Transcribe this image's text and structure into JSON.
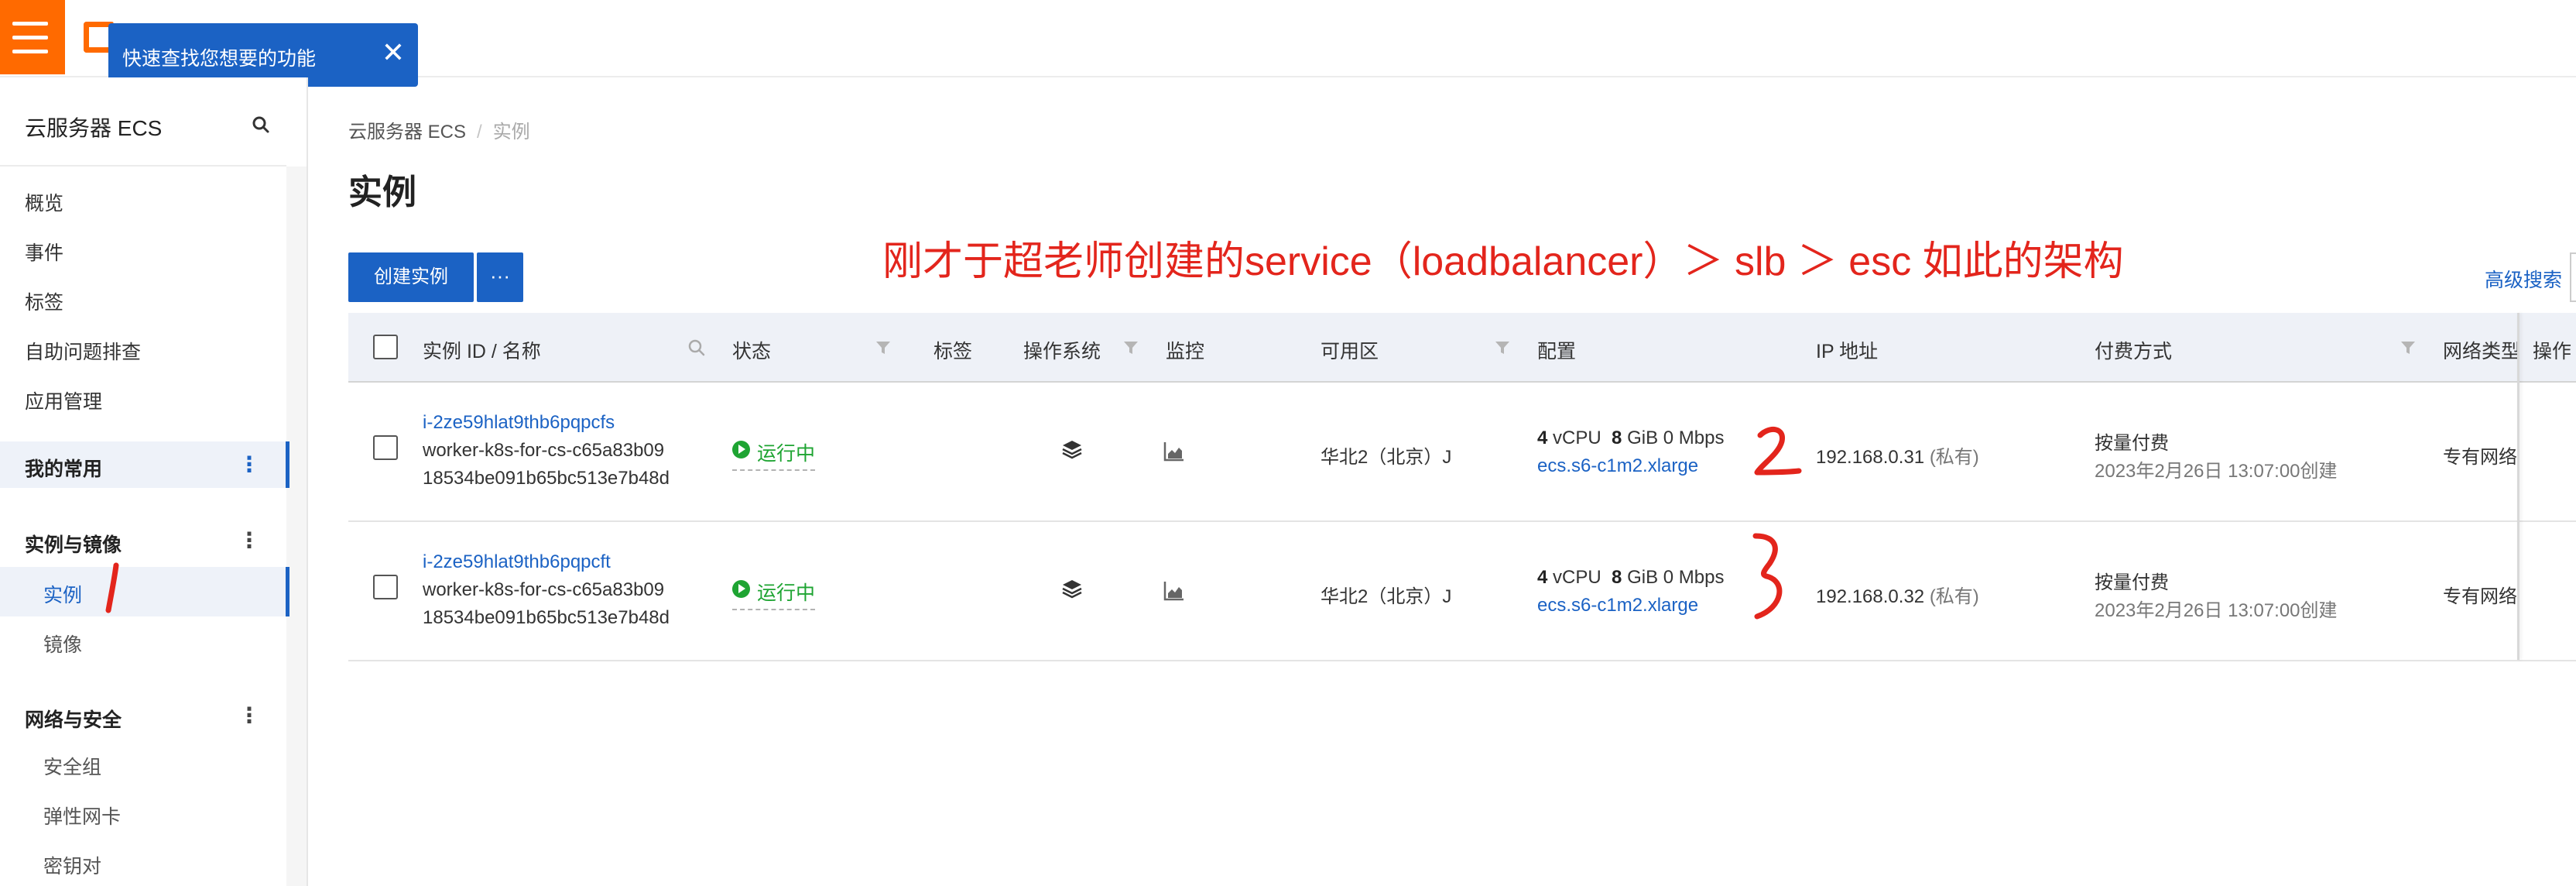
{
  "topbar": {
    "tooltip_text": "快速查找您想要的功能",
    "tooltip_close": "✕"
  },
  "sidebar": {
    "title": "云服务器 ECS",
    "items": [
      {
        "label": "概览"
      },
      {
        "label": "事件"
      },
      {
        "label": "标签"
      },
      {
        "label": "自助问题排查"
      },
      {
        "label": "应用管理"
      }
    ],
    "groups": [
      {
        "label": "我的常用",
        "items": []
      },
      {
        "label": "实例与镜像",
        "items": [
          {
            "label": "实例",
            "active": true
          },
          {
            "label": "镜像"
          }
        ]
      },
      {
        "label": "网络与安全",
        "items": [
          {
            "label": "安全组"
          },
          {
            "label": "弹性网卡"
          },
          {
            "label": "密钥对"
          }
        ]
      }
    ],
    "group_menu": "⋮"
  },
  "breadcrumb": {
    "root": "云服务器 ECS",
    "sep": "/",
    "current": "实例"
  },
  "page": {
    "title": "实例"
  },
  "toolbar": {
    "create_label": "创建实例",
    "more_label": "···",
    "advanced_search": "高级搜索"
  },
  "annotation": {
    "text": "刚才于超老师创建的service（loadbalancer）＞ slb ＞ esc 如此的架构"
  },
  "table": {
    "columns": {
      "id_name": "实例 ID / 名称",
      "status": "状态",
      "tags": "标签",
      "os": "操作系统",
      "monitor": "监控",
      "zone": "可用区",
      "config": "配置",
      "ip": "IP 地址",
      "billing": "付费方式",
      "network": "网络类型",
      "action": "操作"
    },
    "rows": [
      {
        "id": "i-2ze59hlat9thb6pqpcfs",
        "name_line1": "worker-k8s-for-cs-c65a83b09",
        "name_line2": "18534be091b65bc513e7b48d",
        "status": "运行中",
        "zone": "华北2（北京）J",
        "cpu_num": "4",
        "cpu_unit": "vCPU",
        "mem_num": "8",
        "mem_unit": "GiB",
        "bandwidth": "0 Mbps",
        "spec": "ecs.s6-c1m2.xlarge",
        "ip": "192.168.0.31",
        "ip_type": "(私有)",
        "billing": "按量付费",
        "created": "2023年2月26日 13:07:00创建",
        "network": "专有网络"
      },
      {
        "id": "i-2ze59hlat9thb6pqpcft",
        "name_line1": "worker-k8s-for-cs-c65a83b09",
        "name_line2": "18534be091b65bc513e7b48d",
        "status": "运行中",
        "zone": "华北2（北京）J",
        "cpu_num": "4",
        "cpu_unit": "vCPU",
        "mem_num": "8",
        "mem_unit": "GiB",
        "bandwidth": "0 Mbps",
        "spec": "ecs.s6-c1m2.xlarge",
        "ip": "192.168.0.32",
        "ip_type": "(私有)",
        "billing": "按量付费",
        "created": "2023年2月26日 13:07:00创建",
        "network": "专有网络"
      }
    ]
  },
  "handwriting": [
    "1",
    "2",
    "3"
  ],
  "colors": {
    "accent": "#1b62c4",
    "brand": "#ff6a00",
    "running": "#1ea432",
    "annotation": "#e3251c"
  }
}
